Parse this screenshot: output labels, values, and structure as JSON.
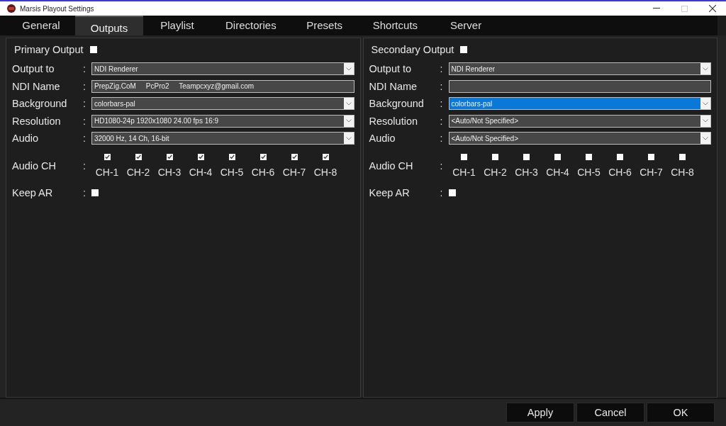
{
  "window": {
    "title": "Marsis Playout Settings"
  },
  "tabs": [
    {
      "label": "General",
      "selected": false
    },
    {
      "label": "Outputs",
      "selected": true
    },
    {
      "label": "Playlist",
      "selected": false
    },
    {
      "label": "Directories",
      "selected": false
    },
    {
      "label": "Presets",
      "selected": false
    },
    {
      "label": "Shortcuts",
      "selected": false
    },
    {
      "label": "Server",
      "selected": false
    }
  ],
  "panels": [
    {
      "title": "Primary Output",
      "enabled": false,
      "fields": [
        {
          "label": "Output to",
          "colon": ":",
          "kind": "dropdown",
          "value": "NDI Renderer",
          "focused": false
        },
        {
          "label": "NDI Name",
          "colon": ":",
          "kind": "text",
          "value": "PrepZig.CoM     PcPro2     Teampcxyz@gmail.com",
          "focused": false
        },
        {
          "label": "Background",
          "colon": ":",
          "kind": "dropdown",
          "value": "colorbars-pal",
          "focused": false
        },
        {
          "label": "Resolution",
          "colon": ":",
          "kind": "dropdown",
          "value": "HD1080-24p 1920x1080 24.00 fps 16:9",
          "focused": false
        },
        {
          "label": "Audio",
          "colon": ":",
          "kind": "dropdown",
          "value": "32000 Hz, 14 Ch, 16-bit",
          "focused": false
        }
      ],
      "audio_ch": {
        "label": "Audio CH",
        "colon": ":",
        "channels": [
          {
            "label": "CH-1",
            "checked": true
          },
          {
            "label": "CH-2",
            "checked": true
          },
          {
            "label": "CH-3",
            "checked": true
          },
          {
            "label": "CH-4",
            "checked": true
          },
          {
            "label": "CH-5",
            "checked": true
          },
          {
            "label": "CH-6",
            "checked": true
          },
          {
            "label": "CH-7",
            "checked": true
          },
          {
            "label": "CH-8",
            "checked": true
          }
        ]
      },
      "keep_ar": {
        "label": "Keep AR",
        "colon": ":",
        "checked": false
      }
    },
    {
      "title": "Secondary Output",
      "enabled": false,
      "fields": [
        {
          "label": "Output to",
          "colon": ":",
          "kind": "dropdown",
          "value": "NDI Renderer",
          "focused": false
        },
        {
          "label": "NDI Name",
          "colon": ":",
          "kind": "text",
          "focused": false
        },
        {
          "label": "Background",
          "colon": ":",
          "kind": "dropdown",
          "value": "colorbars-pal",
          "focused": true
        },
        {
          "label": "Resolution",
          "colon": ":",
          "kind": "dropdown",
          "value": "<Auto/Not Specified>",
          "focused": false
        },
        {
          "label": "Audio",
          "colon": ":",
          "kind": "dropdown",
          "value": "<Auto/Not Specified>",
          "focused": false
        }
      ],
      "audio_ch": {
        "label": "Audio CH",
        "colon": ":",
        "channels": [
          {
            "label": "CH-1",
            "checked": false
          },
          {
            "label": "CH-2",
            "checked": false
          },
          {
            "label": "CH-3",
            "checked": false
          },
          {
            "label": "CH-4",
            "checked": false
          },
          {
            "label": "CH-5",
            "checked": false
          },
          {
            "label": "CH-6",
            "checked": false
          },
          {
            "label": "CH-7",
            "checked": false
          },
          {
            "label": "CH-8",
            "checked": false
          }
        ]
      },
      "keep_ar": {
        "label": "Keep AR",
        "colon": ":",
        "checked": false
      }
    }
  ],
  "buttons": [
    "Apply",
    "Cancel",
    "OK"
  ]
}
